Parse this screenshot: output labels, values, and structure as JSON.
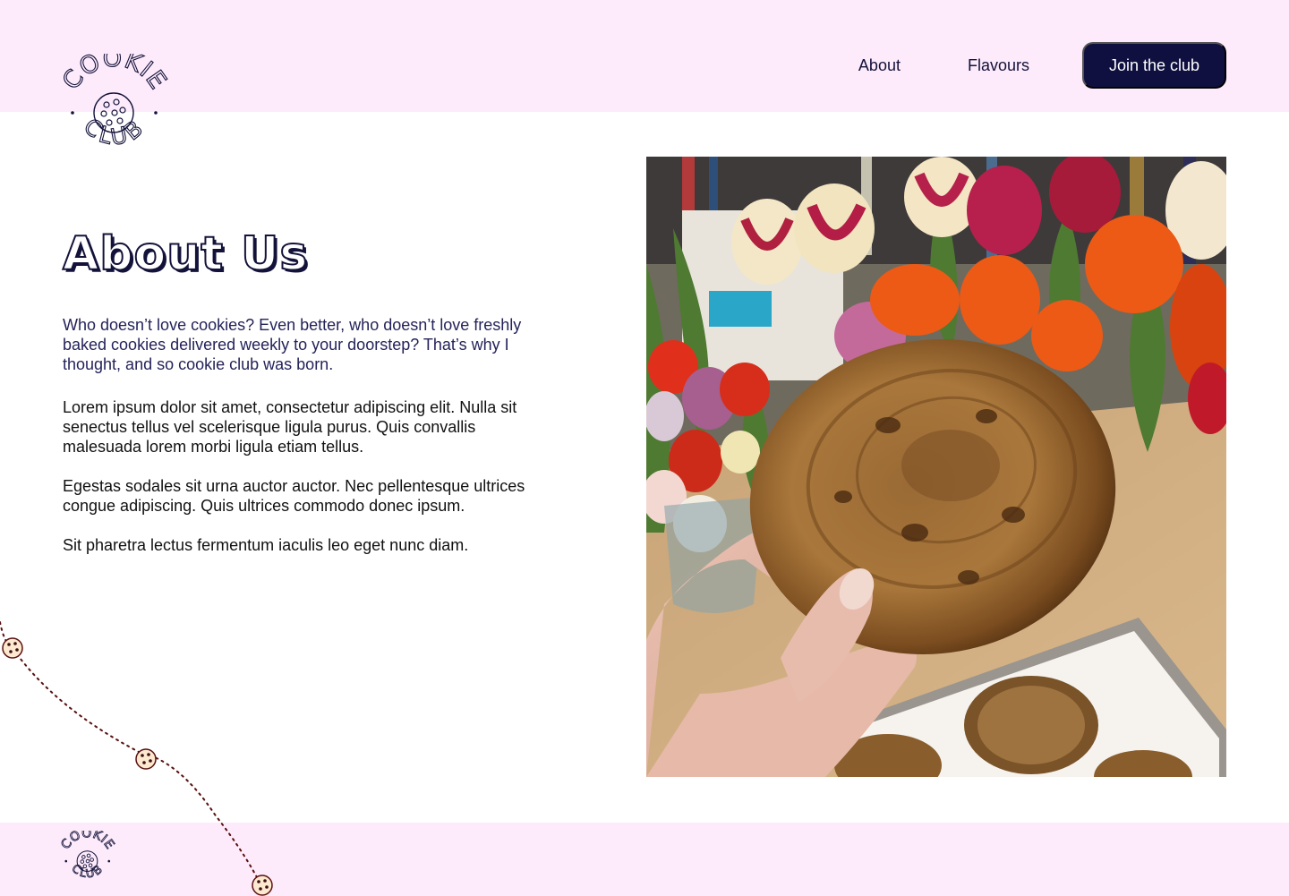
{
  "brand": {
    "logo_text_top": "COOKIE",
    "logo_text_bottom": "CLUB"
  },
  "nav": {
    "items": [
      {
        "label": "About"
      },
      {
        "label": "Flavours"
      }
    ],
    "cta_label": "Join the club"
  },
  "main": {
    "title": "About Us",
    "paragraphs": [
      "Who doesn’t love cookies? Even better, who doesn’t love freshly baked cookies delivered weekly to your doorstep? That’s why I thought, and so cookie club was born.",
      "Lorem ipsum dolor sit amet, consectetur adipiscing elit. Nulla sit senectus tellus vel scelerisque ligula purus. Quis convallis malesuada lorem morbi ligula etiam tellus.",
      "Egestas sodales sit urna auctor auctor. Nec pellentesque ultrices congue adipiscing. Quis ultrices commodo donec ipsum.",
      "Sit pharetra lectus fermentum iaculis leo eget nunc diam."
    ]
  },
  "colors": {
    "header_bg": "#fdebfb",
    "navy": "#101040",
    "trail": "#5a1010",
    "cookie_fill": "#fde9cf"
  },
  "icons": [
    "cookie-club-logo",
    "cookie-icon"
  ]
}
